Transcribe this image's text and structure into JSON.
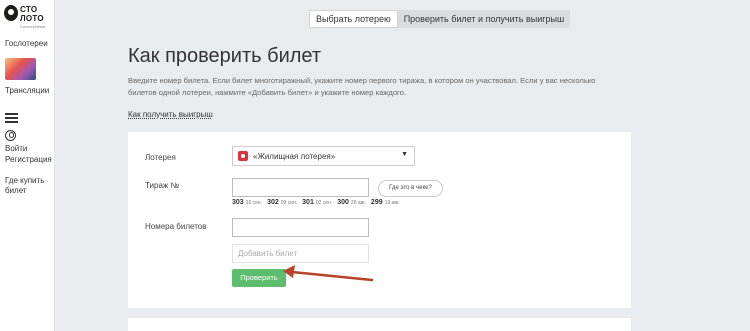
{
  "logo": {
    "line1": "СТО",
    "line2": "ЛОТО",
    "sub": "Гослотерейный"
  },
  "sidebar": {
    "gosloterei": "Гослотереи",
    "translyatsii": "Трансляции",
    "login": "Войти",
    "register": "Регистрация",
    "where_buy_1": "Где купить",
    "where_buy_2": "билет"
  },
  "tabs": [
    {
      "label": "Выбрать лотерею",
      "active": true
    },
    {
      "label": "Проверить билет и получить выигрыш",
      "active": false
    }
  ],
  "page": {
    "title": "Как проверить билет",
    "intro": "Введите номер билета. Если билет многотиражный, укажите номер первого тиража, в котором он участвовал. Если у вас несколько билетов одной лотереи, нажмите «Добавить билет» и укажите номер каждого.",
    "how_win": "Как получить выигрыш"
  },
  "form": {
    "lottery_label": "Лотерея",
    "lottery_value": "«Жилищная лотерея»",
    "draw_label": "Тираж №",
    "draw_value": "",
    "where_btn": "Где это в чеке?",
    "recent_draws": [
      {
        "num": "303",
        "date": "16 сен."
      },
      {
        "num": "302",
        "date": "09 сен."
      },
      {
        "num": "301",
        "date": "02 сен."
      },
      {
        "num": "300",
        "date": "26 авг."
      },
      {
        "num": "299",
        "date": "19 авг."
      }
    ],
    "ticket_label": "Номера билетов",
    "ticket_value": "",
    "add_ticket_placeholder": "Добавить билет",
    "check_button": "Проверить"
  },
  "colors": {
    "check_button": "#5cbe6c",
    "arrow": "#b5442b",
    "background": "#e9ecef"
  }
}
